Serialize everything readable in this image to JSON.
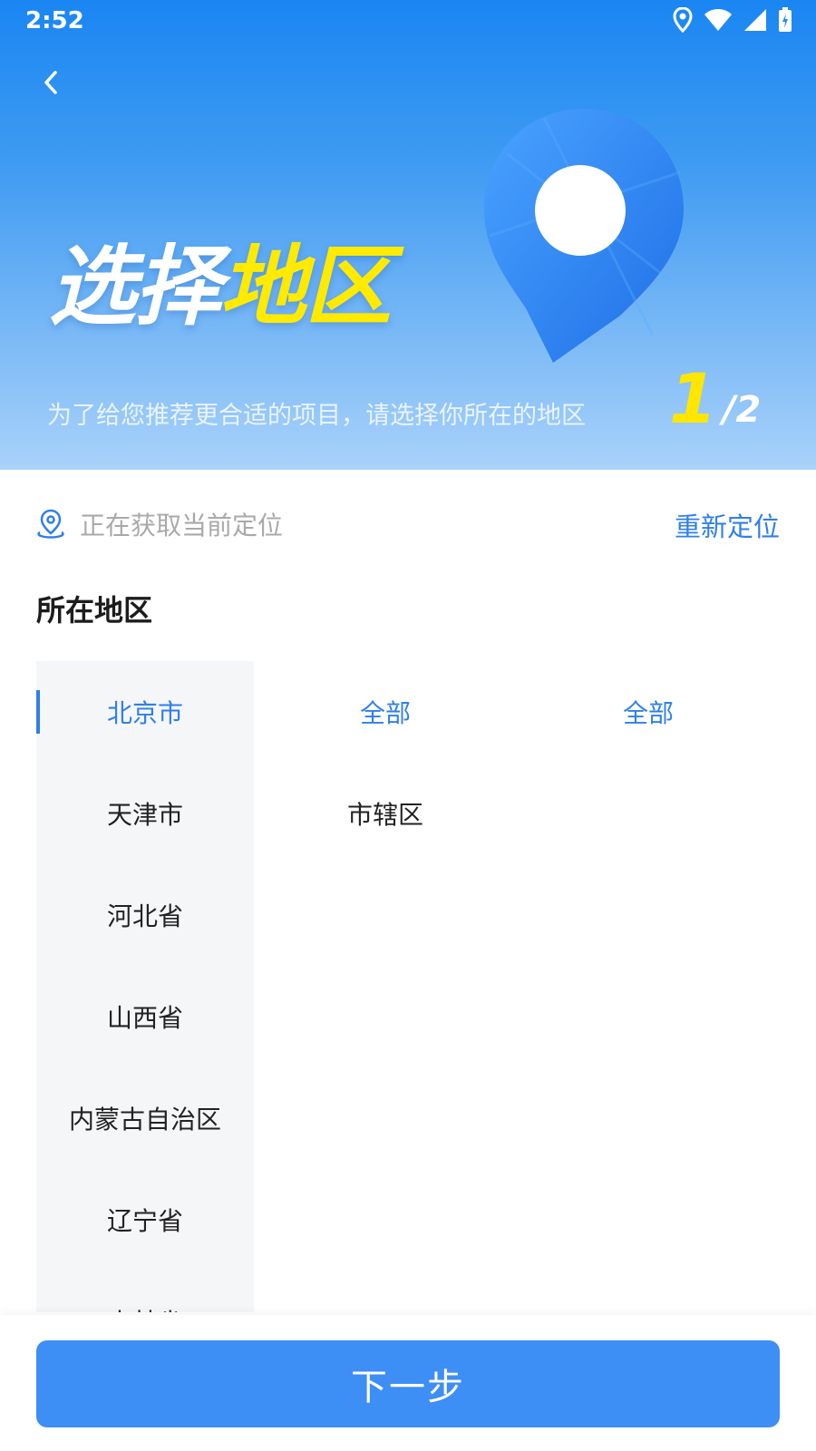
{
  "status_bar": {
    "time": "2:52"
  },
  "header": {
    "title_part1": "选择",
    "title_part2": "地区",
    "subtitle": "为了给您推荐更合适的项目，请选择你所在的地区",
    "step_current": "1",
    "step_total": "/2"
  },
  "location": {
    "status_text": "正在获取当前定位",
    "relocate_label": "重新定位"
  },
  "section_title": "所在地区",
  "picker": {
    "provinces": [
      "北京市",
      "天津市",
      "河北省",
      "山西省",
      "内蒙古自治区",
      "辽宁省",
      "吉林省"
    ],
    "selected_province": "北京市",
    "cities": [
      "全部",
      "市辖区"
    ],
    "selected_city": "全部",
    "districts": [
      "全部"
    ],
    "selected_district": "全部"
  },
  "footer": {
    "next_label": "下一步"
  },
  "colors": {
    "accent": "#2f7fea",
    "button": "#3d8ef5",
    "highlight": "#ffea00"
  },
  "icons": [
    "location-pin-icon",
    "wifi-icon",
    "signal-icon",
    "battery-icon",
    "back-chevron-icon",
    "map-pin-icon"
  ]
}
